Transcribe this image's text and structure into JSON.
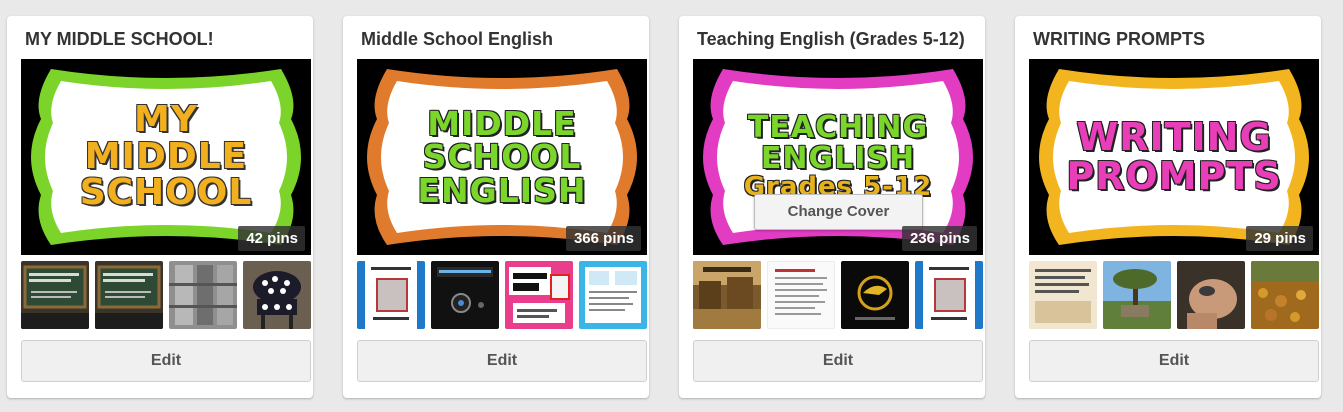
{
  "boards": [
    {
      "title": "MY MIDDLE SCHOOL!",
      "cover_lines": [
        "MY",
        "MIDDLE",
        "SCHOOL"
      ],
      "cover_frame_color": "#7cd42a",
      "cover_text_color": "#f2b01e",
      "pins": "42 pins",
      "thumbnails": [
        "ccss-writing-chalkboard",
        "ccss-writing-chalkboard",
        "library-shelves",
        "polka-dot-chair"
      ],
      "edit_label": "Edit"
    },
    {
      "title": "Middle School English",
      "cover_lines": [
        "MIDDLE",
        "SCHOOL",
        "ENGLISH"
      ],
      "cover_frame_color": "#e07a2c",
      "cover_text_color": "#7bd62b",
      "pins": "366 pins",
      "thumbnails": [
        "outsiders-study-guide",
        "digital-storytelling",
        "words-that-pop",
        "worksheet-blue"
      ],
      "edit_label": "Edit"
    },
    {
      "title": "Teaching English (Grades 5-12)",
      "cover_lines": [
        "TEACHING",
        "ENGLISH",
        "Grades 5-12"
      ],
      "cover_frame_color": "#e23cc3",
      "cover_text_color": "#7bd62b",
      "pins": "236 pins",
      "change_cover_label": "Change Cover",
      "thumbnails": [
        "western-town",
        "document-page",
        "mockingjay",
        "outsiders-study-guide"
      ],
      "edit_label": "Edit"
    },
    {
      "title": "WRITING PROMPTS",
      "cover_lines": [
        "WRITING",
        "PROMPTS"
      ],
      "cover_frame_color": "#f2b51f",
      "cover_text_color": "#e83fb8",
      "pins": "29 pins",
      "thumbnails": [
        "prompt-text-card",
        "tree-landscape",
        "hand-close-up",
        "autumn-field"
      ],
      "edit_label": "Edit"
    }
  ]
}
